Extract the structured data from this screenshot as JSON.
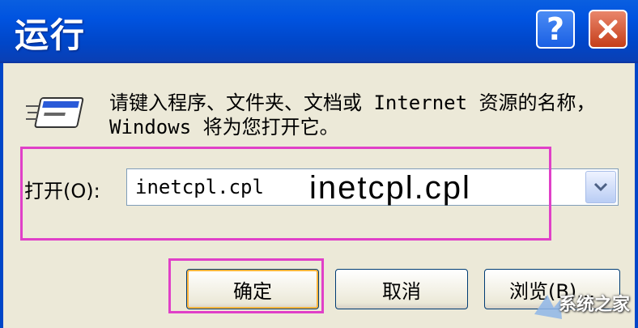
{
  "window": {
    "title": "运行",
    "help_icon": "question-mark-icon",
    "close_icon": "close-x-icon"
  },
  "dialog": {
    "description": "请键入程序、文件夹、文档或 Internet 资源的名称，Windows 将为您打开它。",
    "open_label": "打开(O):",
    "open_value": "inetcpl.cpl",
    "annotation": "inetcpl.cpl"
  },
  "buttons": {
    "ok": "确定",
    "cancel": "取消",
    "browse": "浏览(B)..."
  },
  "watermark": {
    "text": "系统之家"
  },
  "colors": {
    "titlebar": "#0053e0",
    "highlight": "#e040c8",
    "close": "#c53e1a"
  }
}
